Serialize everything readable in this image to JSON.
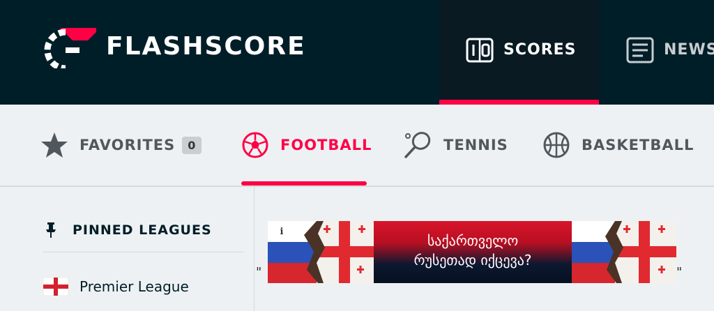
{
  "header": {
    "logo_text": "FLASHSCORE",
    "nav": [
      {
        "label": "SCORES",
        "icon": "scoreboard-icon",
        "active": true
      },
      {
        "label": "NEWS",
        "icon": "newspaper-icon",
        "active": false
      }
    ],
    "accent_color": "#ff0046",
    "background_color": "#001e28"
  },
  "sports_tabs": [
    {
      "label": "FAVORITES",
      "icon": "star-icon",
      "badge": "0",
      "active": false
    },
    {
      "label": "FOOTBALL",
      "icon": "football-icon",
      "active": true
    },
    {
      "label": "TENNIS",
      "icon": "tennis-racket-icon",
      "active": false
    },
    {
      "label": "BASKETBALL",
      "icon": "basketball-icon",
      "active": false
    }
  ],
  "sidebar": {
    "pinned_title": "PINNED LEAGUES",
    "pinned_icon": "pin-icon",
    "leagues": [
      {
        "name": "Premier League",
        "icon": "england-flag-icon"
      }
    ]
  },
  "ad": {
    "line1": "საქართველო",
    "line2": "რუსეთად იქცევა?",
    "quote_open": "\"",
    "quote_close": "\"",
    "info_label": "i"
  }
}
